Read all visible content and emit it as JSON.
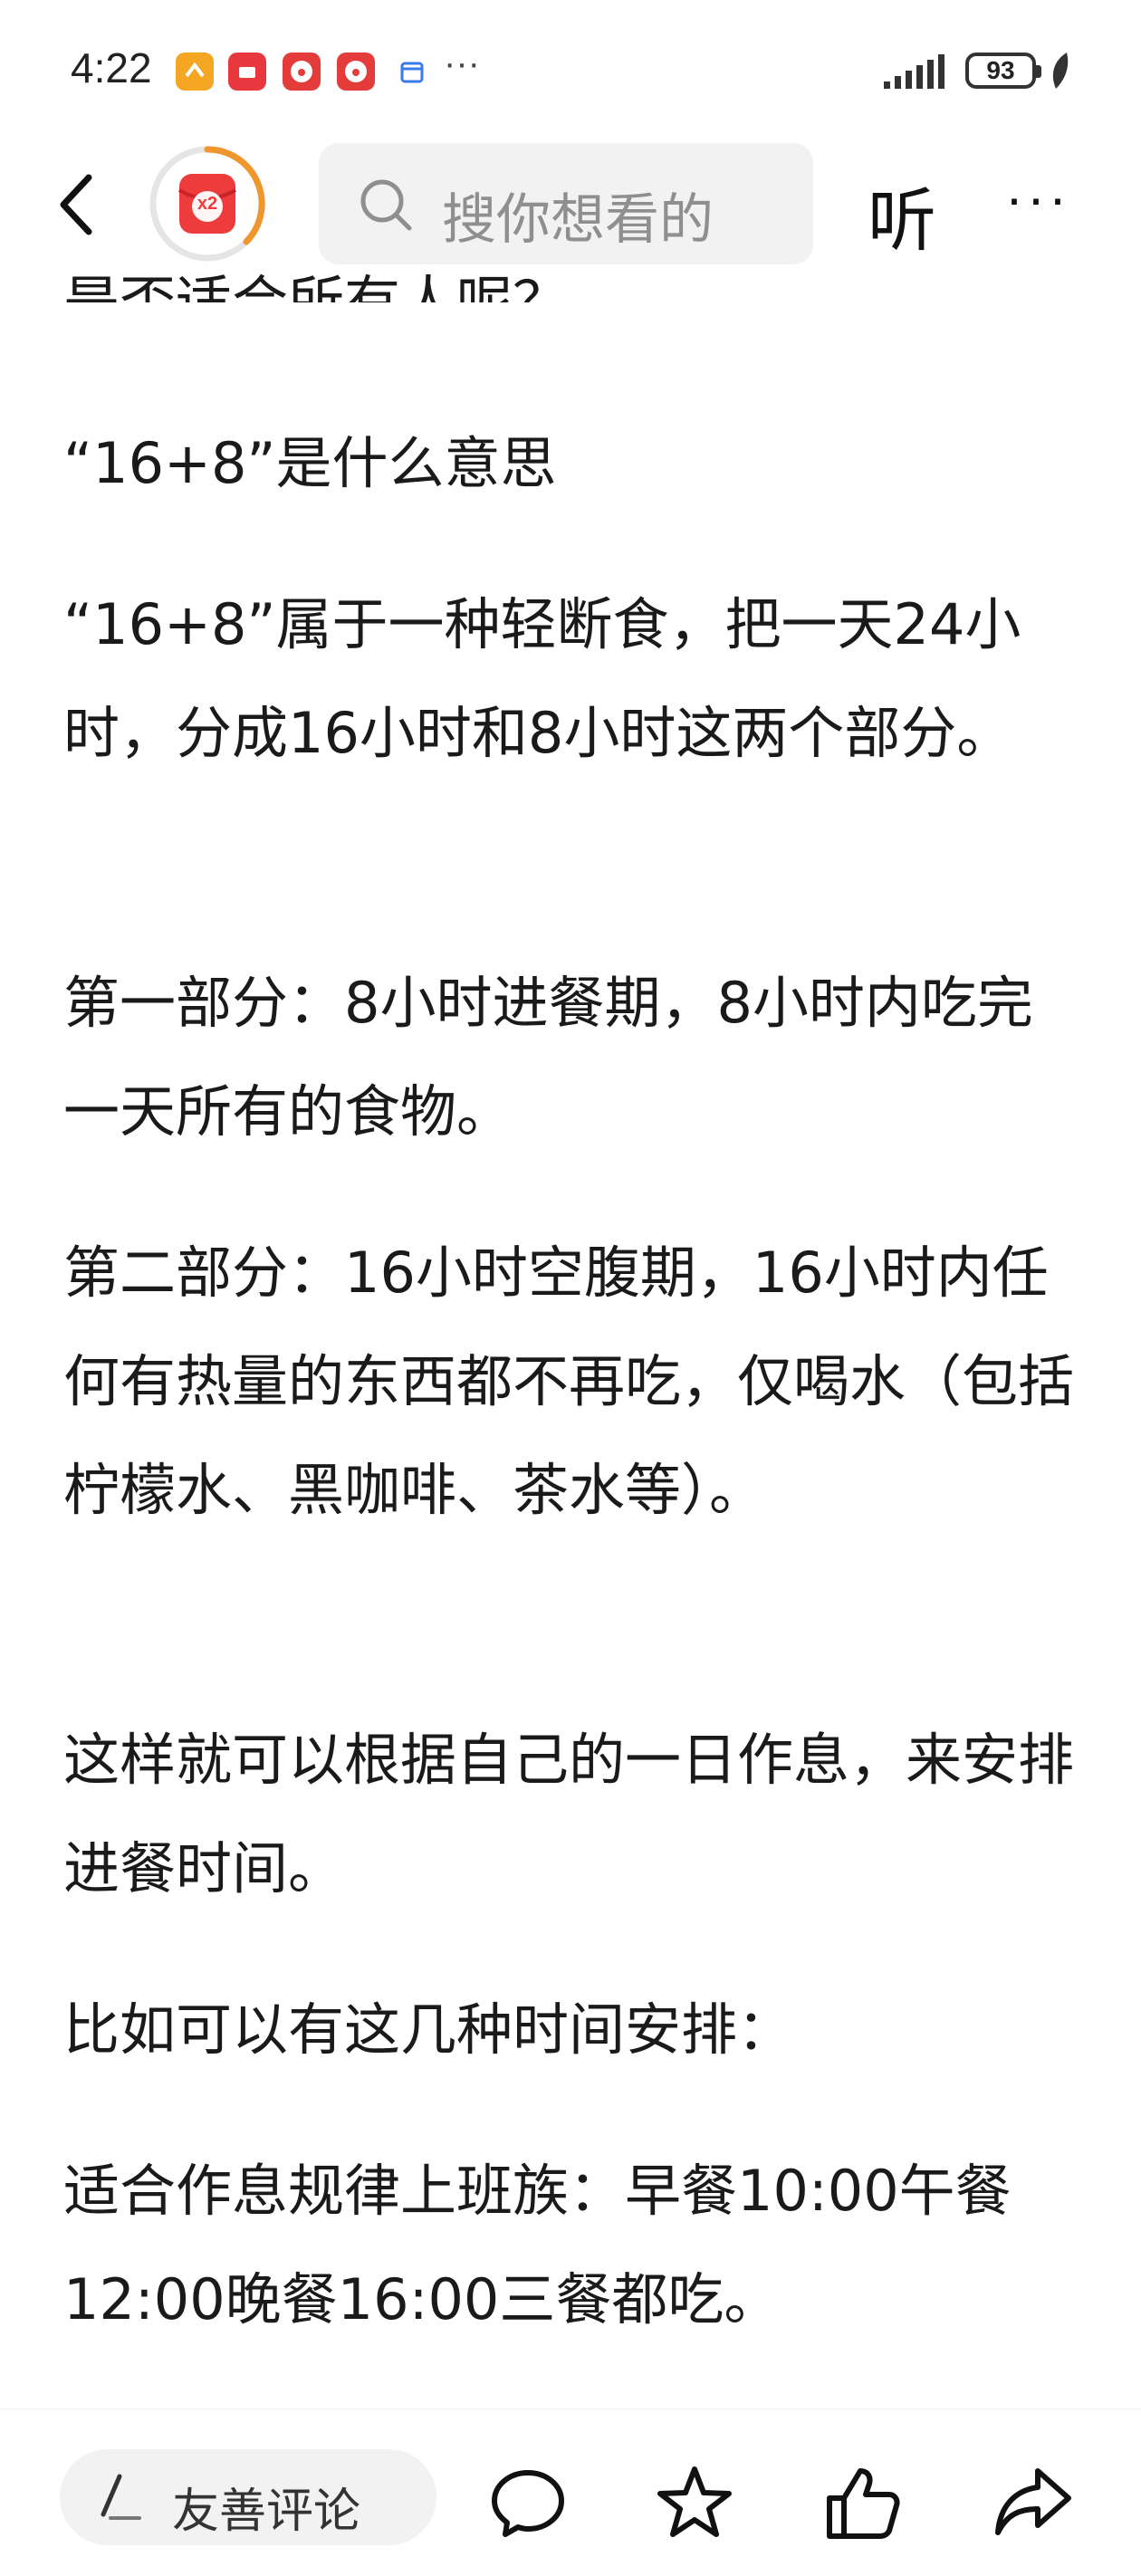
{
  "status_bar": {
    "time": "4:22",
    "more": "···",
    "battery_level": "93",
    "notification_icons": [
      "app-icon-orange",
      "huawei-app-icon",
      "clown-app-icon",
      "clown-app-icon",
      "calendar-icon"
    ]
  },
  "header": {
    "search_placeholder": "搜你想看的",
    "listen_label": "听",
    "menu_label": "···",
    "badge_label": "x2",
    "accent_color": "#f0962e"
  },
  "article": {
    "top_partial_line": "是否适合所有人呢？",
    "paragraphs": [
      "“16+8”是什么意思",
      "“16+8”属于一种轻断食，把一天24小时，分成16小时和8小时这两个部分。",
      "第一部分：8小时进餐期，8小时内吃完一天所有的食物。",
      "第二部分：16小时空腹期，16小时内任何有热量的东西都不再吃，仅喝水（包括柠檬水、黑咖啡、茶水等）。",
      "这样就可以根据自己的一日作息，来安排进餐时间。",
      "比如可以有这几种时间安排：",
      "适合作息规律上班族：早餐10:00午餐12:00晚餐16:00三餐都吃。"
    ]
  },
  "bottom_bar": {
    "comment_placeholder": "友善评论",
    "actions": [
      "comment-icon",
      "star-icon",
      "like-icon",
      "share-icon"
    ]
  }
}
